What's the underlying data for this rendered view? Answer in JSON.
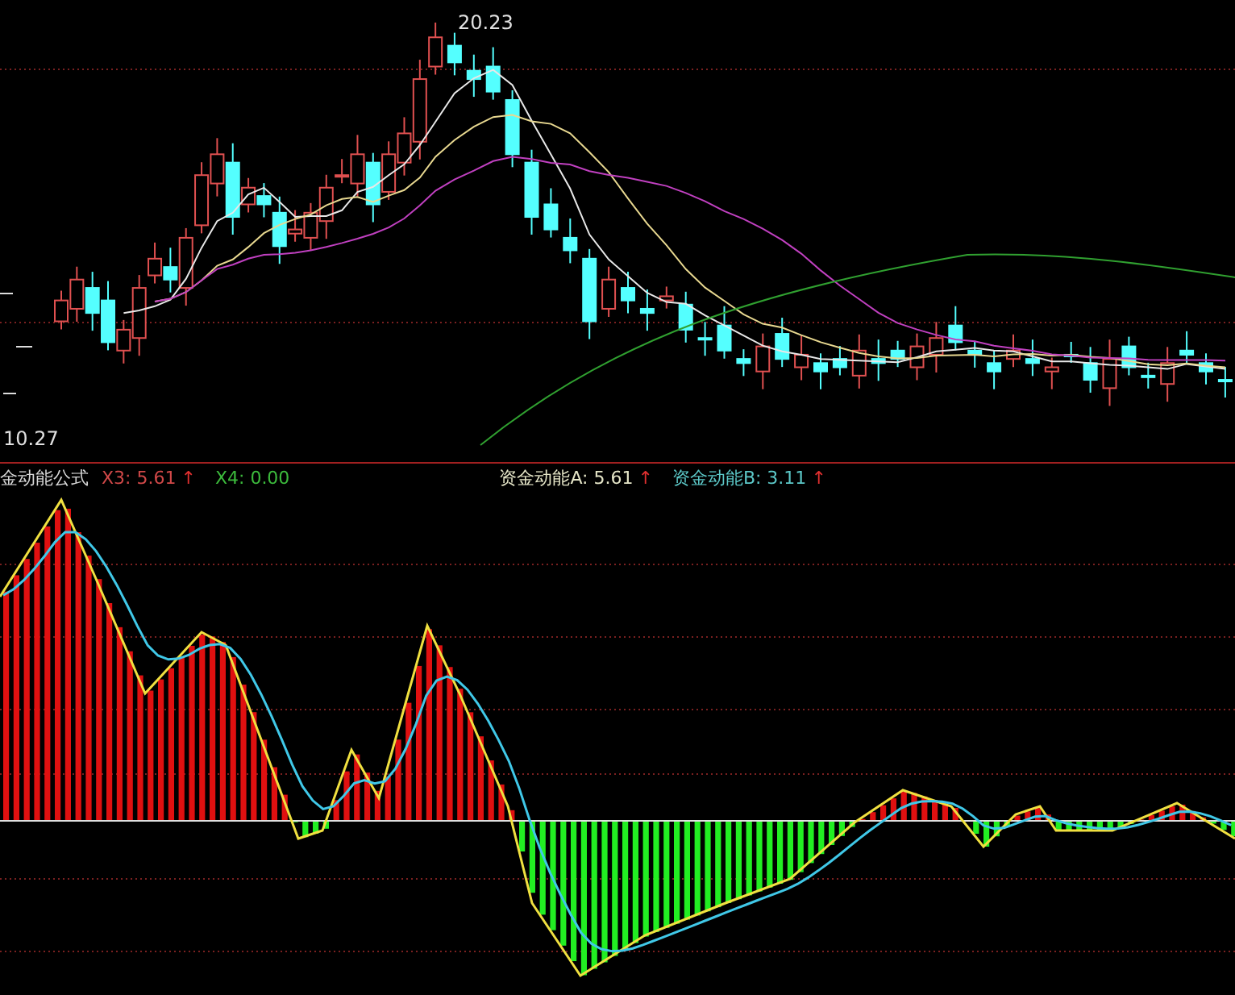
{
  "price_chart": {
    "high_label": "20.23",
    "low_label": "10.27"
  },
  "indicator": {
    "legend": [
      {
        "kind": "title",
        "text": "金动能公式",
        "color": "#d8d8d8"
      },
      {
        "kind": "value",
        "text": "X3: 5.61",
        "color": "#d04848",
        "arrow": "↑"
      },
      {
        "kind": "value",
        "text": "X4: 0.00",
        "color": "#3cba3c"
      },
      {
        "kind": "value",
        "text": "资金动能A: 5.61",
        "color": "#e6e6c8",
        "arrow": "↑"
      },
      {
        "kind": "value",
        "text": "资金动能B: 3.11",
        "color": "#5cc8c8",
        "arrow": "↑"
      }
    ]
  }
}
